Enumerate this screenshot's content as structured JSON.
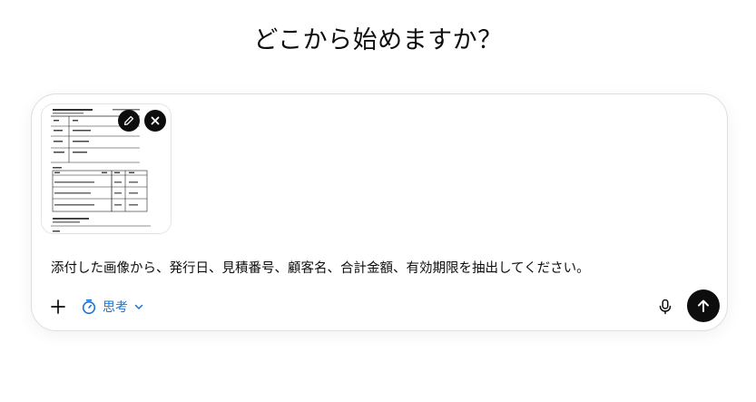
{
  "heading": "どこから始めますか？",
  "composer": {
    "attachment": {
      "type": "image",
      "thumbnail_icon": "document-table-thumbnail",
      "edit_icon": "pencil-icon",
      "remove_icon": "close-icon"
    },
    "prompt_text": "添付した画像から、発行日、見積番号、顧客名、合計金額、有効期限を抽出してください。",
    "toolbar": {
      "add_icon": "plus-icon",
      "mode_label": "思考",
      "mode_icon": "timer-icon",
      "mode_chevron": "chevron-down-icon",
      "mic_icon": "microphone-icon",
      "send_icon": "arrow-up-icon"
    }
  },
  "colors": {
    "accent": "#1a73d9",
    "send_button": "#0d0d0d",
    "border": "#dedede"
  }
}
